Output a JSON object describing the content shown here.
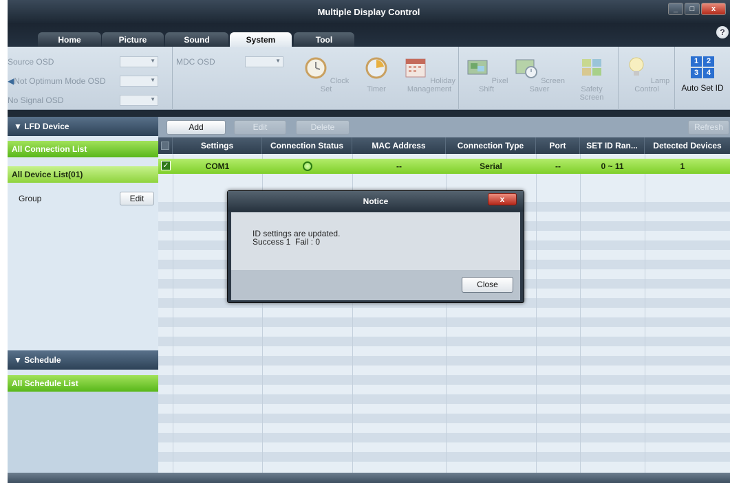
{
  "window": {
    "title": "Multiple Display Control",
    "minimize_label": "_",
    "maximize_label": "□",
    "close_label": "x",
    "help_label": "?"
  },
  "tabs": [
    {
      "label": "Home"
    },
    {
      "label": "Picture"
    },
    {
      "label": "Sound"
    },
    {
      "label": "System"
    },
    {
      "label": "Tool"
    }
  ],
  "active_tab": "System",
  "ribbon": {
    "source_osd": "Source OSD",
    "not_optimum_osd": "Not Optimum Mode OSD",
    "no_signal_osd": "No Signal OSD",
    "mdc_osd": "MDC OSD",
    "clock_set": "Clock Set",
    "timer": "Timer",
    "holiday_1": "Holiday",
    "holiday_2": "Management",
    "pixel_shift": "Pixel Shift",
    "screen_saver": "Screen Saver",
    "safety_1": "Safety",
    "safety_2": "Screen",
    "lamp_control": "Lamp Control",
    "auto_set_id": "Auto Set ID",
    "id_digits": [
      "1",
      "2",
      "3",
      "4"
    ]
  },
  "left": {
    "lfd_device": "LFD Device",
    "all_connection_list": "All Connection List",
    "all_device_list": "All Device List(01)",
    "group": "Group",
    "edit": "Edit",
    "schedule": "Schedule",
    "all_schedule_list": "All Schedule List"
  },
  "toolbar": {
    "add": "Add",
    "edit": "Edit",
    "delete": "Delete",
    "refresh": "Refresh"
  },
  "table": {
    "headers": [
      "Settings",
      "Connection Status",
      "MAC Address",
      "Connection Type",
      "Port",
      "SET ID Ran...",
      "Detected Devices"
    ],
    "row": {
      "settings": "COM1",
      "mac": "--",
      "type": "Serial",
      "port": "--",
      "set_id_range": "0 ~ 11",
      "detected": "1"
    }
  },
  "dialog": {
    "title": "Notice",
    "close_x": "x",
    "line1": "ID settings are updated.",
    "line2": "Success 1  Fail : 0",
    "button": "Close"
  }
}
